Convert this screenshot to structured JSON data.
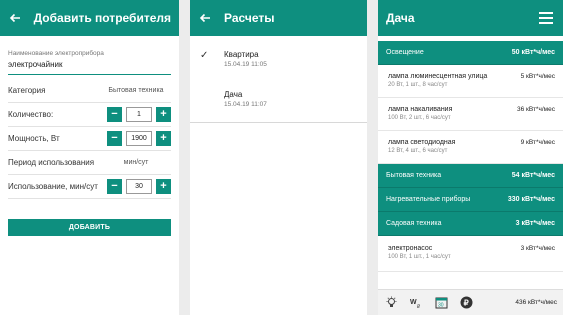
{
  "screen1": {
    "title": "Добавить потребителя",
    "name_label": "Наименование электроприбора",
    "name_value": "электрочайник",
    "category_label": "Категория",
    "category_value": "Бытовая техника",
    "quantity_label": "Количество:",
    "quantity_value": "1",
    "power_label": "Мощность, Вт",
    "power_value": "1900",
    "period_label": "Период использования",
    "period_value": "мин/сут",
    "usage_label": "Использование, мин/сут",
    "usage_value": "30",
    "minus": "−",
    "plus": "+",
    "add_button": "ДОБАВИТЬ"
  },
  "screen2": {
    "title": "Расчеты",
    "check": "✓",
    "items": [
      {
        "name": "Квартира",
        "date": "15.04.19 11:05"
      },
      {
        "name": "Дача",
        "date": "15.04.19 11:07"
      }
    ]
  },
  "screen3": {
    "title": "Дача",
    "categories": [
      {
        "name": "Освещение",
        "value": "50 кВт*ч/мес"
      },
      {
        "name": "Бытовая техника",
        "value": "54 кВт*ч/мес"
      },
      {
        "name": "Нагревательные приборы",
        "value": "330 кВт*ч/мес"
      },
      {
        "name": "Садовая техника",
        "value": "3 кВт*ч/мес"
      }
    ],
    "lighting_items": [
      {
        "name": "лампа люминесцентная улица",
        "detail": "20 Вт, 1 шт., 8 час/сут",
        "value": "5 кВт*ч/мес"
      },
      {
        "name": "лампа накаливания",
        "detail": "100 Вт, 2 шт., 6 час/сут",
        "value": "36 кВт*ч/мес"
      },
      {
        "name": "лампа светодиодная",
        "detail": "12 Вт, 4 шт., 6 час/сут",
        "value": "9 кВт*ч/мес"
      }
    ],
    "garden_items": [
      {
        "name": "электронасос",
        "detail": "100 Вт, 1 шт., 1 час/сут",
        "value": "3 кВт*ч/мес"
      }
    ],
    "bottom_icons": [
      "lightbulb-icon",
      "watt-price-icon",
      "calendar-30-icon",
      "ruble-icon"
    ],
    "calendar_label": "30",
    "total": "436 кВт*ч/мес",
    "accent": "#0e8f7f"
  }
}
